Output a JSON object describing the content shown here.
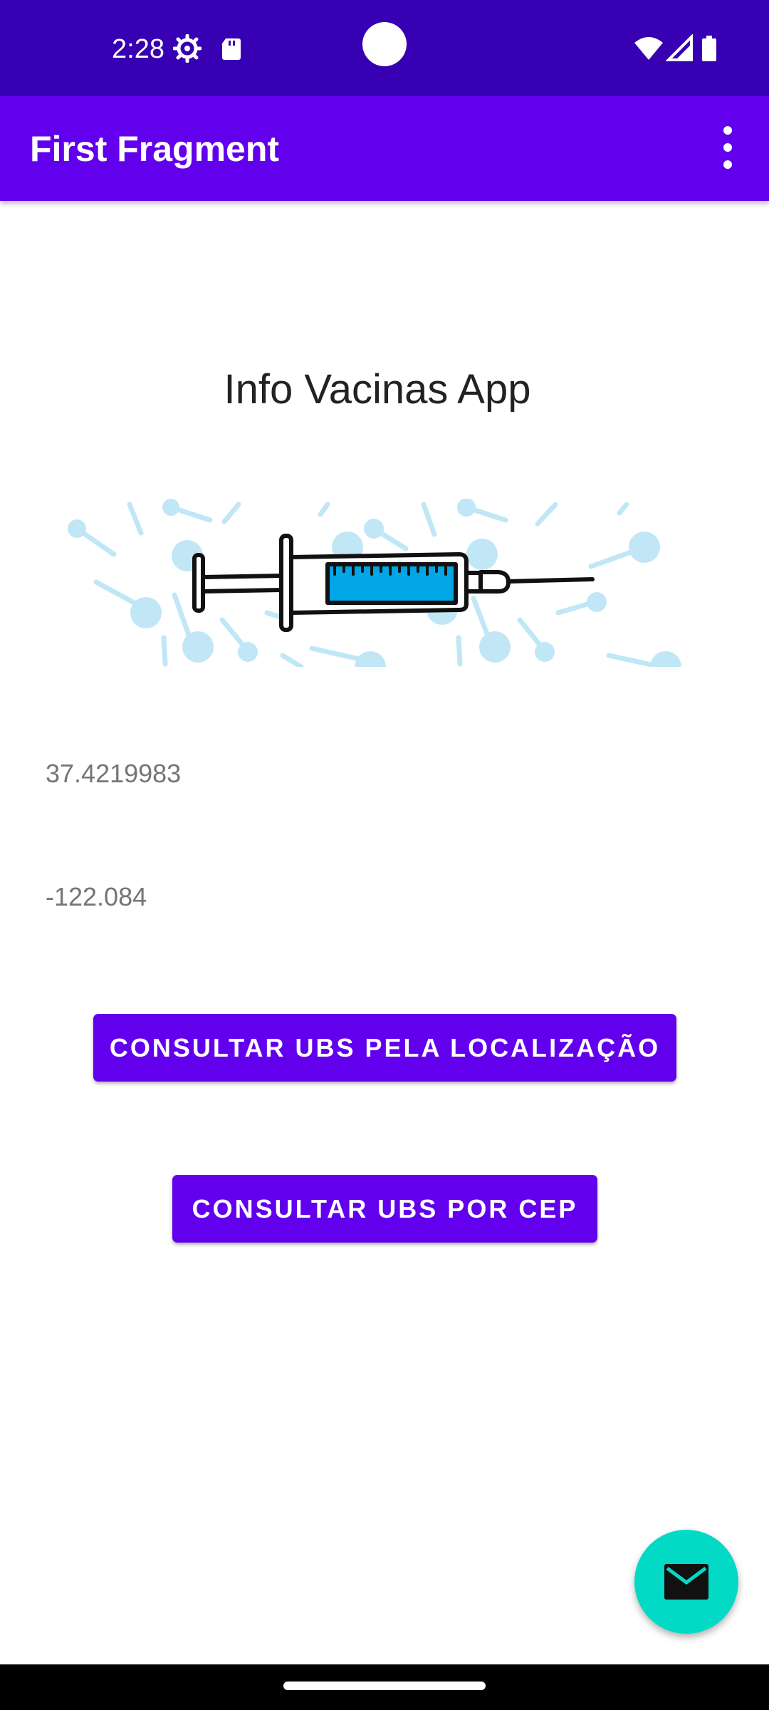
{
  "status_bar": {
    "time": "2:28",
    "icons": [
      "settings-icon",
      "sd-card-icon",
      "wifi-icon",
      "cellular-signal-icon",
      "battery-icon"
    ],
    "background_color": "#3700b3"
  },
  "app_bar": {
    "title": "First Fragment",
    "menu_icon": "more-vert-icon",
    "background_color": "#6200ee"
  },
  "main": {
    "headline": "Info Vacinas App",
    "illustration": "syringe-illustration",
    "latitude": "37.4219983",
    "longitude": "-122.084",
    "buttons": {
      "by_location_label": "CONSULTAR UBS PELA LOCALIZAÇÃO",
      "by_cep_label": "CONSULTAR UBS POR CEP"
    },
    "accent_color": "#6200ee"
  },
  "fab": {
    "icon": "email-icon",
    "background_color": "#03dac5"
  }
}
